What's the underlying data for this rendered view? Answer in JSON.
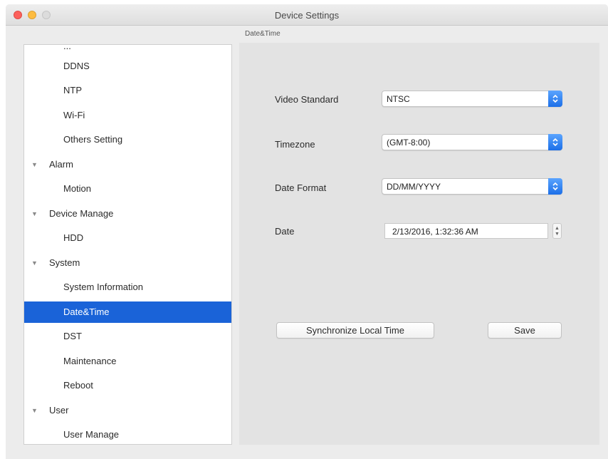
{
  "window": {
    "title": "Device Settings"
  },
  "section_label": "Date&Time",
  "sidebar": {
    "clipped_top_label": "...",
    "items": [
      {
        "label": "DDNS",
        "kind": "child"
      },
      {
        "label": "NTP",
        "kind": "child"
      },
      {
        "label": "Wi-Fi",
        "kind": "child"
      },
      {
        "label": "Others Setting",
        "kind": "child"
      },
      {
        "label": "Alarm",
        "kind": "group"
      },
      {
        "label": "Motion",
        "kind": "child"
      },
      {
        "label": "Device Manage",
        "kind": "group"
      },
      {
        "label": "HDD",
        "kind": "child"
      },
      {
        "label": "System",
        "kind": "group"
      },
      {
        "label": "System Information",
        "kind": "child"
      },
      {
        "label": "Date&Time",
        "kind": "child",
        "selected": true
      },
      {
        "label": "DST",
        "kind": "child"
      },
      {
        "label": "Maintenance",
        "kind": "child"
      },
      {
        "label": "Reboot",
        "kind": "child"
      },
      {
        "label": "User",
        "kind": "group"
      },
      {
        "label": "User Manage",
        "kind": "child"
      }
    ],
    "expand_triangle": "▼"
  },
  "form": {
    "video_standard": {
      "label": "Video Standard",
      "value": "NTSC"
    },
    "timezone": {
      "label": "Timezone",
      "value": "(GMT-8:00)"
    },
    "date_format": {
      "label": "Date Format",
      "value": "DD/MM/YYYY"
    },
    "date": {
      "label": "Date",
      "value": "2/13/2016,   1:32:36 AM"
    }
  },
  "buttons": {
    "sync_label": "Synchronize Local Time",
    "save_label": "Save"
  },
  "colors": {
    "selection": "#1a63d8",
    "popup_arrow": "#1c6fe8",
    "panel_bg": "#e3e3e3",
    "window_bg": "#ececec"
  },
  "icons": {
    "popup_arrows": "chevron-updown-icon",
    "stepper": "stepper-icon"
  }
}
